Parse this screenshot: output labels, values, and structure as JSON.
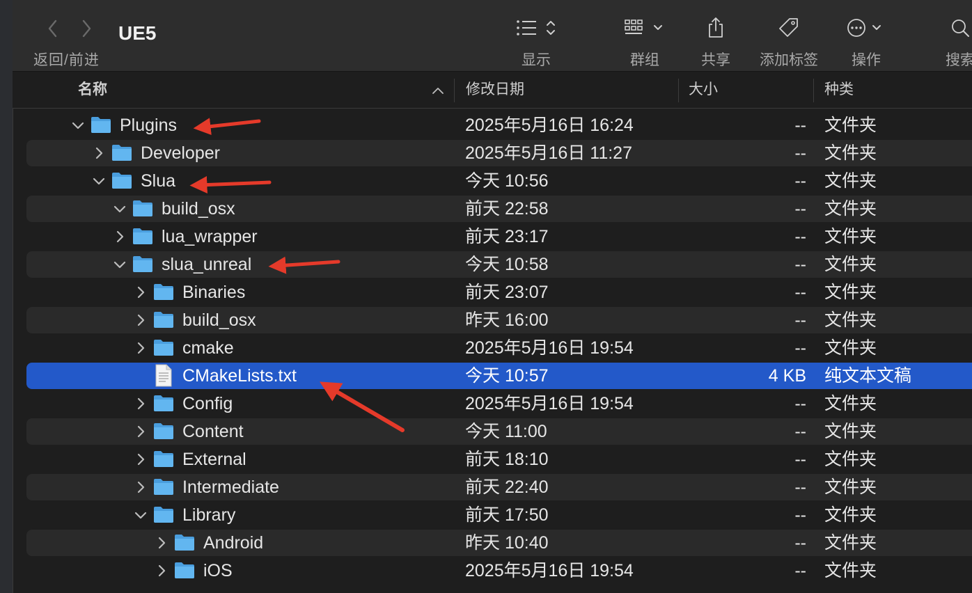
{
  "window": {
    "title": "UE5",
    "nav_label": "返回/前进"
  },
  "toolbar": {
    "items": [
      {
        "label": "显示",
        "icon": "list-view-icon"
      },
      {
        "label": "群组",
        "icon": "group-grid-icon"
      },
      {
        "label": "共享",
        "icon": "share-icon"
      },
      {
        "label": "添加标签",
        "icon": "tag-icon"
      },
      {
        "label": "操作",
        "icon": "more-actions-icon"
      },
      {
        "label": "搜索",
        "icon": "search-icon"
      }
    ]
  },
  "columns": {
    "name": "名称",
    "modified": "修改日期",
    "size": "大小",
    "kind": "种类"
  },
  "colors": {
    "folder": "#62b6f0",
    "selection": "#2359c9",
    "annotation_arrow": "#e53a2a"
  },
  "rows": [
    {
      "name": "Plugins",
      "modified": "2025年5月16日 16:24",
      "size": "--",
      "kind": "文件夹",
      "depth": 0,
      "expanded": true,
      "type": "folder"
    },
    {
      "name": "Developer",
      "modified": "2025年5月16日 11:27",
      "size": "--",
      "kind": "文件夹",
      "depth": 1,
      "expanded": false,
      "type": "folder"
    },
    {
      "name": "Slua",
      "modified": "今天 10:56",
      "size": "--",
      "kind": "文件夹",
      "depth": 1,
      "expanded": true,
      "type": "folder"
    },
    {
      "name": "build_osx",
      "modified": "前天 22:58",
      "size": "--",
      "kind": "文件夹",
      "depth": 2,
      "expanded": true,
      "type": "folder"
    },
    {
      "name": "lua_wrapper",
      "modified": "前天 23:17",
      "size": "--",
      "kind": "文件夹",
      "depth": 2,
      "expanded": false,
      "type": "folder"
    },
    {
      "name": "slua_unreal",
      "modified": "今天 10:58",
      "size": "--",
      "kind": "文件夹",
      "depth": 2,
      "expanded": true,
      "type": "folder"
    },
    {
      "name": "Binaries",
      "modified": "前天 23:07",
      "size": "--",
      "kind": "文件夹",
      "depth": 3,
      "expanded": false,
      "type": "folder"
    },
    {
      "name": "build_osx",
      "modified": "昨天 16:00",
      "size": "--",
      "kind": "文件夹",
      "depth": 3,
      "expanded": false,
      "type": "folder"
    },
    {
      "name": "cmake",
      "modified": "2025年5月16日 19:54",
      "size": "--",
      "kind": "文件夹",
      "depth": 3,
      "expanded": false,
      "type": "folder"
    },
    {
      "name": "CMakeLists.txt",
      "modified": "今天 10:57",
      "size": "4 KB",
      "kind": "纯文本文稿",
      "depth": 3,
      "type": "file",
      "selected": true
    },
    {
      "name": "Config",
      "modified": "2025年5月16日 19:54",
      "size": "--",
      "kind": "文件夹",
      "depth": 3,
      "expanded": false,
      "type": "folder"
    },
    {
      "name": "Content",
      "modified": "今天 11:00",
      "size": "--",
      "kind": "文件夹",
      "depth": 3,
      "expanded": false,
      "type": "folder"
    },
    {
      "name": "External",
      "modified": "前天 18:10",
      "size": "--",
      "kind": "文件夹",
      "depth": 3,
      "expanded": false,
      "type": "folder"
    },
    {
      "name": "Intermediate",
      "modified": "前天 22:40",
      "size": "--",
      "kind": "文件夹",
      "depth": 3,
      "expanded": false,
      "type": "folder"
    },
    {
      "name": "Library",
      "modified": "前天 17:50",
      "size": "--",
      "kind": "文件夹",
      "depth": 3,
      "expanded": true,
      "type": "folder"
    },
    {
      "name": "Android",
      "modified": "昨天 10:40",
      "size": "--",
      "kind": "文件夹",
      "depth": 4,
      "expanded": false,
      "type": "folder"
    },
    {
      "name": "iOS",
      "modified": "2025年5月16日 19:54",
      "size": "--",
      "kind": "文件夹",
      "depth": 4,
      "expanded": false,
      "type": "folder"
    }
  ]
}
